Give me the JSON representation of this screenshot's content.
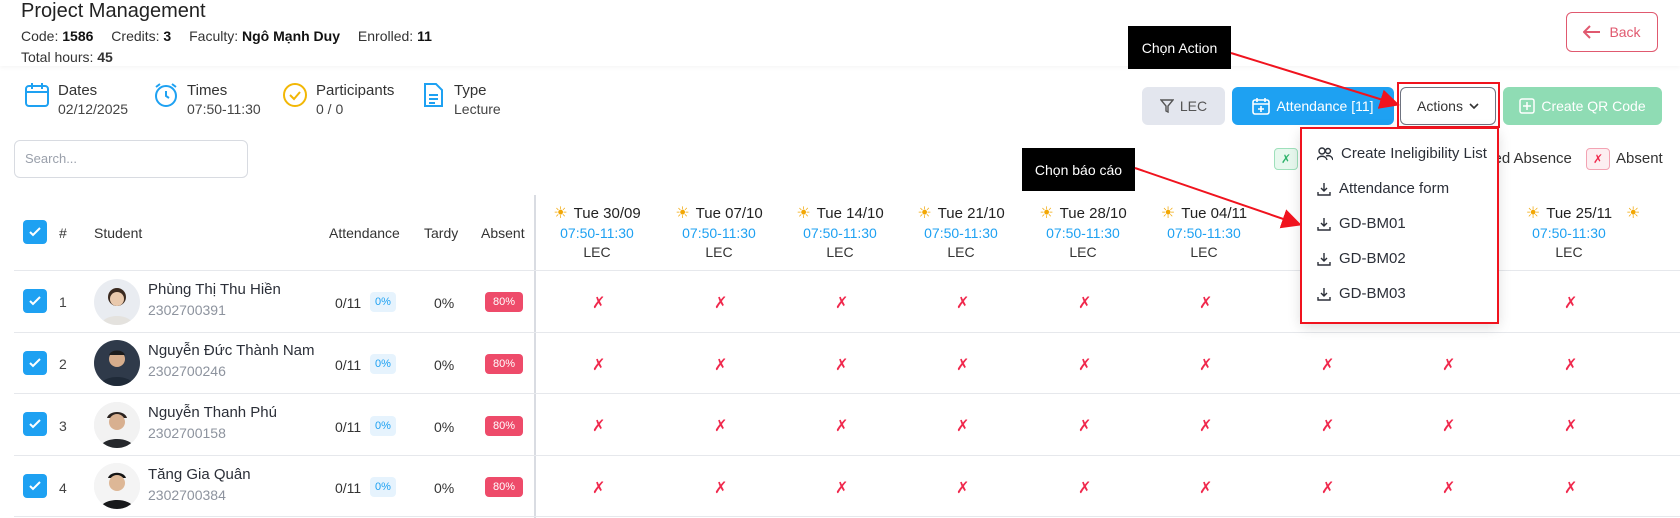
{
  "header": {
    "title": "Project Management",
    "code_label": "Code:",
    "code": "1586",
    "credits_label": "Credits:",
    "credits": "3",
    "faculty_label": "Faculty:",
    "faculty": "Ngô Mạnh Duy",
    "enrolled_label": "Enrolled:",
    "enrolled": "11",
    "total_hours_label": "Total hours:",
    "total_hours": "45",
    "back_label": "Back"
  },
  "info": {
    "dates_label": "Dates",
    "dates_value": "02/12/2025",
    "times_label": "Times",
    "times_value": "07:50-11:30",
    "participants_label": "Participants",
    "participants_value": "0 / 0",
    "type_label": "Type",
    "type_value": "Lecture"
  },
  "toolbar": {
    "lec_label": "LEC",
    "attendance_label": "Attendance [11]",
    "actions_label": "Actions",
    "qr_label": "Create QR Code"
  },
  "search": {
    "placeholder": "Search..."
  },
  "legend": {
    "excused_mark": "✗",
    "excused_label": "sed Absence",
    "absent_mark": "✗",
    "absent_label": "Absent"
  },
  "table": {
    "headers": {
      "number": "#",
      "student": "Student",
      "attendance": "Attendance",
      "tardy": "Tardy",
      "absent": "Absent"
    },
    "sessions": [
      {
        "date": "Tue 30/09",
        "time": "07:50-11:30",
        "kind": "LEC"
      },
      {
        "date": "Tue 07/10",
        "time": "07:50-11:30",
        "kind": "LEC"
      },
      {
        "date": "Tue 14/10",
        "time": "07:50-11:30",
        "kind": "LEC"
      },
      {
        "date": "Tue 21/10",
        "time": "07:50-11:30",
        "kind": "LEC"
      },
      {
        "date": "Tue 28/10",
        "time": "07:50-11:30",
        "kind": "LEC"
      },
      {
        "date": "Tue 04/11",
        "time": "07:50-11:30",
        "kind": "LEC"
      },
      {
        "date": "Tue 25/11",
        "time": "07:50-11:30",
        "kind": "LEC"
      }
    ],
    "rows": [
      {
        "num": "1",
        "name": "Phùng Thị Thu Hiền",
        "id": "2302700391",
        "attendance": "0/11",
        "att_pct": "0%",
        "tardy": "0%",
        "absent": "80%"
      },
      {
        "num": "2",
        "name": "Nguyễn Đức Thành Nam",
        "id": "2302700246",
        "attendance": "0/11",
        "att_pct": "0%",
        "tardy": "0%",
        "absent": "80%"
      },
      {
        "num": "3",
        "name": "Nguyễn Thanh Phú",
        "id": "2302700158",
        "attendance": "0/11",
        "att_pct": "0%",
        "tardy": "0%",
        "absent": "80%"
      },
      {
        "num": "4",
        "name": "Tăng Gia Quân",
        "id": "2302700384",
        "attendance": "0/11",
        "att_pct": "0%",
        "tardy": "0%",
        "absent": "80%"
      }
    ],
    "absent_mark": "✗"
  },
  "dropdown": {
    "items": [
      {
        "label": "Create Ineligibility List",
        "icon": "users-icon"
      },
      {
        "label": "Attendance form",
        "icon": "download-icon"
      },
      {
        "label": "GD-BM01",
        "icon": "download-icon"
      },
      {
        "label": "GD-BM02",
        "icon": "download-icon"
      },
      {
        "label": "GD-BM03",
        "icon": "download-icon"
      }
    ]
  },
  "callouts": {
    "action": "Chọn Action",
    "report": "Chọn báo cáo"
  },
  "colors": {
    "primary": "#1ea1f2",
    "danger": "#ee4b6a",
    "annotation_red": "#f0131e",
    "qr_green": "#8fdcb4"
  }
}
